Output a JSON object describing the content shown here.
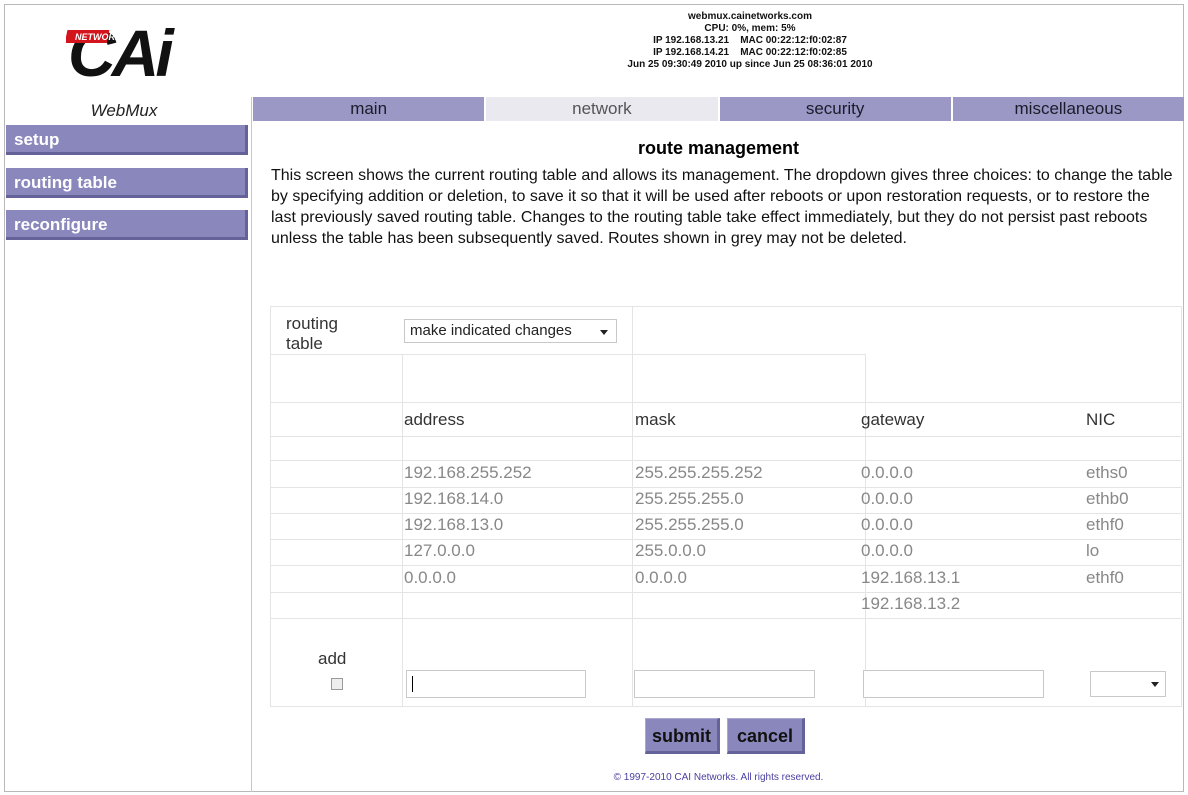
{
  "brand": {
    "logo_text": "CAi",
    "logo_sub": "NETWORKS",
    "product": "WebMux"
  },
  "system": {
    "hostname": "webmux.cainetworks.com",
    "cpu_mem": "CPU: 0%, mem: 5%",
    "ip1": "IP 192.168.13.21    MAC 00:22:12:f0:02:87",
    "ip2": "IP 192.168.14.21    MAC 00:22:12:f0:02:85",
    "uptime": "Jun 25 09:30:49 2010 up since Jun 25 08:36:01 2010"
  },
  "tabs": [
    {
      "label": "main",
      "active": false
    },
    {
      "label": "network",
      "active": true
    },
    {
      "label": "security",
      "active": false
    },
    {
      "label": "miscellaneous",
      "active": false
    }
  ],
  "sidebar": {
    "items": [
      {
        "label": "setup"
      },
      {
        "label": "routing table"
      },
      {
        "label": "reconfigure"
      }
    ]
  },
  "page": {
    "title": "route management",
    "description": "This screen shows the current routing table and allows its management. The dropdown gives three choices: to change the table by specifying addition or deletion, to save it so that it will be used after reboots or upon restoration requests, or to restore the last previously saved routing table. Changes to the routing table take effect immediately, but they do not persist past reboots unless the table has been subsequently saved. Routes shown in grey may not be deleted."
  },
  "form": {
    "routing_table_label": "routing table",
    "action_selected": "make indicated changes",
    "columns": {
      "address": "address",
      "mask": "mask",
      "gateway": "gateway",
      "nic": "NIC"
    },
    "rows": [
      {
        "address": "192.168.255.252",
        "mask": "255.255.255.252",
        "gateway": "0.0.0.0",
        "nic": "eths0"
      },
      {
        "address": "192.168.14.0",
        "mask": "255.255.255.0",
        "gateway": "0.0.0.0",
        "nic": "ethb0"
      },
      {
        "address": "192.168.13.0",
        "mask": "255.255.255.0",
        "gateway": "0.0.0.0",
        "nic": "ethf0"
      },
      {
        "address": "127.0.0.0",
        "mask": "255.0.0.0",
        "gateway": "0.0.0.0",
        "nic": "lo"
      },
      {
        "address": "0.0.0.0",
        "mask": "0.0.0.0",
        "gateway": "192.168.13.1",
        "nic": "ethf0"
      },
      {
        "address": "",
        "mask": "",
        "gateway": "192.168.13.2",
        "nic": ""
      }
    ],
    "add_label": "add",
    "add_row": {
      "address": "",
      "mask": "",
      "gateway": "",
      "nic": ""
    },
    "submit_label": "submit",
    "cancel_label": "cancel"
  },
  "footer": {
    "copyright": "© 1997-2010 CAI Networks. All rights reserved."
  },
  "colors": {
    "accent": "#8a87bd",
    "tab_bg": "#9b98c5",
    "active_tab_bg": "#e9e9ef",
    "logo_red": "#d4141c"
  }
}
